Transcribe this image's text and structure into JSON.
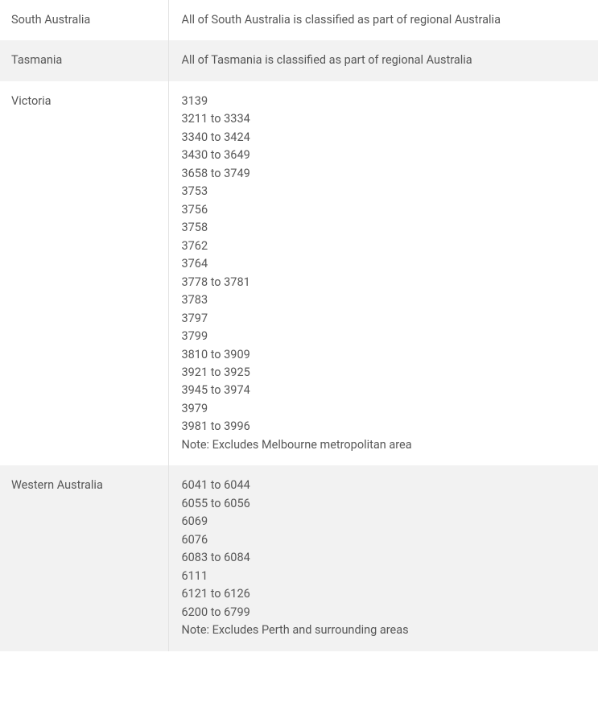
{
  "rows": [
    {
      "region": "South Australia",
      "lines": [
        "All of South Australia is classified as part of regional Australia"
      ]
    },
    {
      "region": "Tasmania",
      "lines": [
        "All of Tasmania is classified as part of regional Australia"
      ]
    },
    {
      "region": "Victoria",
      "lines": [
        "3139",
        "3211 to 3334",
        "3340 to 3424",
        "3430 to 3649",
        "3658 to 3749",
        "3753",
        "3756",
        "3758",
        "3762",
        "3764",
        "3778 to 3781",
        "3783",
        "3797",
        "3799",
        "3810 to 3909",
        "3921 to 3925",
        "3945 to 3974",
        "3979",
        "3981 to 3996",
        "Note: Excludes Melbourne metropolitan area"
      ]
    },
    {
      "region": "Western Australia",
      "lines": [
        "6041 to 6044",
        "6055 to 6056",
        "6069",
        "6076",
        "6083 to 6084",
        "6111",
        "6121 to 6126",
        "6200 to 6799",
        "Note: Excludes Perth and surrounding areas"
      ]
    }
  ]
}
